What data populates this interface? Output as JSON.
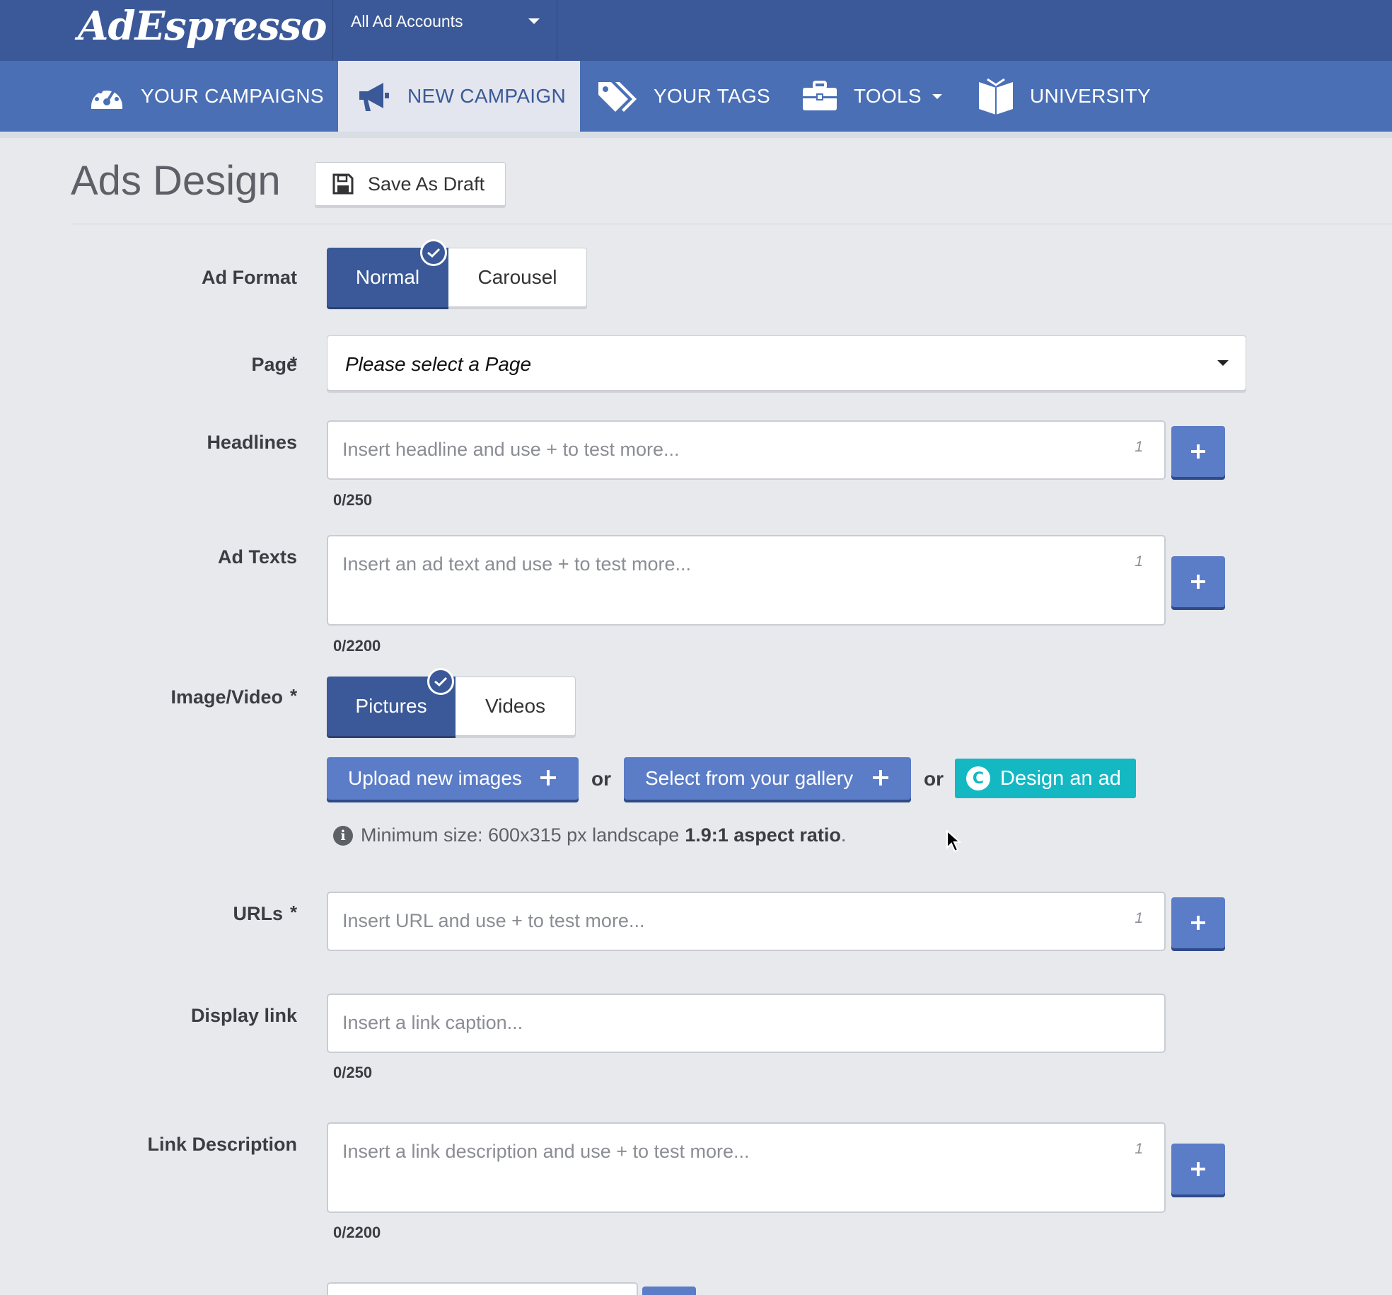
{
  "header": {
    "logo": "AdEspresso",
    "account_selector": "All Ad Accounts"
  },
  "nav": {
    "items": [
      {
        "label": "YOUR CAMPAIGNS",
        "icon": "dashboard-icon"
      },
      {
        "label": "NEW CAMPAIGN",
        "icon": "megaphone-icon",
        "active": true
      },
      {
        "label": "YOUR TAGS",
        "icon": "tags-icon"
      },
      {
        "label": "TOOLS",
        "icon": "briefcase-icon",
        "dropdown": true
      },
      {
        "label": "UNIVERSITY",
        "icon": "book-icon"
      }
    ]
  },
  "page": {
    "title": "Ads Design",
    "save_draft": "Save As Draft"
  },
  "form": {
    "ad_format": {
      "label": "Ad Format",
      "options": [
        "Normal",
        "Carousel"
      ],
      "selected": "Normal"
    },
    "page": {
      "label": "Page",
      "required": "*",
      "placeholder": "Please select a Page"
    },
    "headlines": {
      "label": "Headlines",
      "placeholder": "Insert headline and use + to test more...",
      "index": "1",
      "count": "0/250"
    },
    "ad_texts": {
      "label": "Ad Texts",
      "placeholder": "Insert an ad text and use + to test more...",
      "index": "1",
      "count": "0/2200"
    },
    "image_video": {
      "label": "Image/Video",
      "required": "*",
      "options": [
        "Pictures",
        "Videos"
      ],
      "selected": "Pictures",
      "upload_button": "Upload new images",
      "or": "or",
      "gallery_button": "Select from your gallery",
      "design_button": "Design an ad",
      "design_logo": "C",
      "hint_prefix": "Minimum size: 600x315 px landscape",
      "hint_bold": "1.9:1 aspect ratio",
      "hint_suffix": "."
    },
    "urls": {
      "label": "URLs",
      "required": "*",
      "placeholder": "Insert URL and use + to test more...",
      "index": "1"
    },
    "display_link": {
      "label": "Display link",
      "placeholder": "Insert a link caption...",
      "count": "0/250"
    },
    "link_description": {
      "label": "Link Description",
      "placeholder": "Insert a link description and use + to test more...",
      "index": "1",
      "count": "0/2200"
    }
  },
  "colors": {
    "topbar": "#3b5998",
    "nav": "#4a6fb5",
    "button": "#5b7cc7",
    "canva": "#13b8c3",
    "background": "#e8e9ed"
  }
}
